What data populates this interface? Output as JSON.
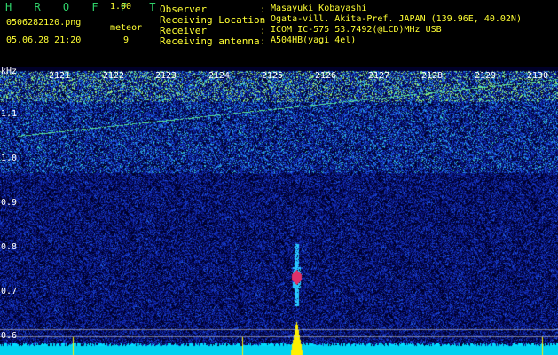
{
  "header": {
    "program_title": "H R O F F T",
    "version": "1.00",
    "filename": "0506282120.png",
    "meteor_label": "meteor",
    "meteor_count": "9",
    "datetime": "05.06.28 21:20",
    "info": [
      {
        "label": "Observer",
        "value": "Masayuki Kobayashi"
      },
      {
        "label": "Receiving Location",
        "value": "Ogata-vill. Akita-Pref. JAPAN (139.96E, 40.02N)"
      },
      {
        "label": "Receiver",
        "value": "ICOM IC-575 53.7492(@LCD)MHz USB"
      },
      {
        "label": "Receiving antenna",
        "value": "A504HB(yagi 4el)"
      }
    ]
  },
  "spectrogram": {
    "y_unit": "kHz",
    "y_ticks": [
      "1.1",
      "1.0",
      "0.9",
      "0.8",
      "0.7",
      "0.6"
    ],
    "minute_labels": [
      "2121",
      "2122",
      "2123",
      "2124",
      "2125",
      "2126",
      "2127",
      "2128",
      "2129",
      "2130"
    ],
    "colors": {
      "background": "#000000",
      "label_text": "#2fd36a",
      "value_text": "#ffff33",
      "axis_text": "#ffffff",
      "meteor_echo": "#e0306a",
      "baseline": "#00e5ff"
    }
  }
}
